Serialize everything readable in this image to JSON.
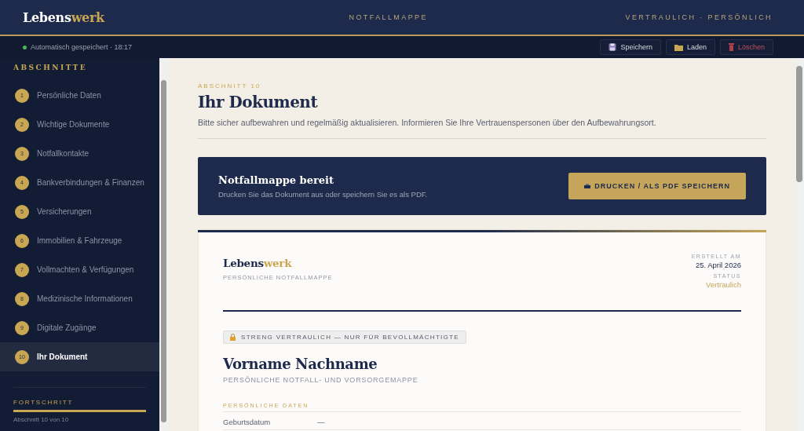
{
  "header": {
    "logo": {
      "main": "Lebens",
      "accent": "werk"
    },
    "center": "NOTFALLMAPPE",
    "right": "VERTRAULICH · PERSÖNLICH"
  },
  "toolbar": {
    "autosave": "Automatisch gespeichert · 18:17",
    "buttons": [
      {
        "kind": "save",
        "label": "Speichern"
      },
      {
        "kind": "load",
        "label": "Laden"
      },
      {
        "kind": "delete",
        "label": "Löschen"
      }
    ]
  },
  "sidebar": {
    "title": "ABSCHNITTE",
    "items": [
      {
        "number": "1",
        "label": "Persönliche Daten",
        "selected": false
      },
      {
        "number": "2",
        "label": "Wichtige Dokumente",
        "selected": false
      },
      {
        "number": "3",
        "label": "Notfallkontakte",
        "selected": false
      },
      {
        "number": "4",
        "label": "Bankverbindungen & Finanzen",
        "selected": false
      },
      {
        "number": "5",
        "label": "Versicherungen",
        "selected": false
      },
      {
        "number": "6",
        "label": "Immobilien & Fahrzeuge",
        "selected": false
      },
      {
        "number": "7",
        "label": "Vollmachten & Verfügungen",
        "selected": false
      },
      {
        "number": "8",
        "label": "Medizinische Informationen",
        "selected": false
      },
      {
        "number": "9",
        "label": "Digitale Zugänge",
        "selected": false
      },
      {
        "number": "10",
        "label": "Ihr Dokument",
        "selected": true
      }
    ],
    "progress": {
      "label": "FORTSCHRITT",
      "level": 1,
      "caption": "Abschnitt 10 von 10"
    }
  },
  "main": {
    "eyebrow": "ABSCHNITT 10",
    "title": "Ihr Dokument",
    "description": "Bitte sicher aufbewahren und regelmäßig aktualisieren. Informieren Sie Ihre Vertrauenspersonen über den Aufbewahrungsort.",
    "banner": {
      "title": "Notfallmappe bereit",
      "text": "Drucken Sie das Dokument aus oder speichern Sie es als PDF.",
      "button": "DRUCKEN / ALS PDF SPEICHERN"
    },
    "document": {
      "logo": {
        "main": "Lebens",
        "accent": "werk"
      },
      "subtitle": "PERSÖNLICHE NOTFALLMAPPE",
      "meta": [
        {
          "label": "ERSTELLT AM",
          "value": "25. April 2026",
          "kind": "plain"
        },
        {
          "label": "STATUS",
          "value": "Vertraulich",
          "kind": "accent"
        }
      ],
      "badge": "STRENG VERTRAULICH — NUR FÜR BEVOLLMÄCHTIGTE",
      "name": "Vorname Nachname",
      "name_subtitle": "PERSÖNLICHE NOTFALL- UND VORSORGEMAPPE",
      "section": "PERSÖNLICHE DATEN",
      "fields": [
        {
          "label": "Geburtsdatum",
          "value": "—"
        }
      ]
    }
  }
}
